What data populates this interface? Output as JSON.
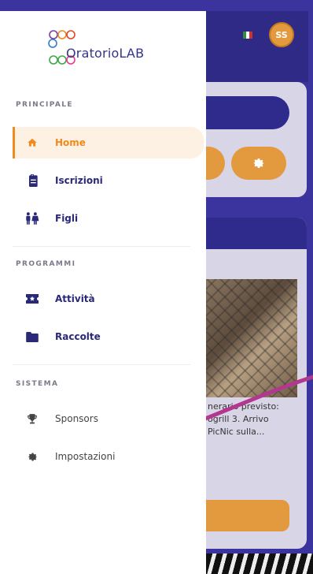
{
  "brand": {
    "name": "OratorioLAB"
  },
  "header": {
    "avatar_initials": "SS",
    "language": "it"
  },
  "sections": {
    "principale": "PRINCIPALE",
    "programmi": "PROGRAMMI",
    "sistema": "SISTEMA"
  },
  "nav": {
    "home": "Home",
    "iscrizioni": "Iscrizioni",
    "figli": "Figli",
    "attivita": "Attività",
    "raccolte": "Raccolte",
    "sponsors": "Sponsors",
    "impostazioni": "Impostazioni",
    "active": "home"
  },
  "background_card": {
    "description": "nerario previsto:\nogrill 3. Arrivo\nPicNic sulla..."
  },
  "colors": {
    "accent": "#f08a1c",
    "primary": "#2f2b8c",
    "backdrop": "#3b349e",
    "annotation_arrow": "#b4378f"
  }
}
